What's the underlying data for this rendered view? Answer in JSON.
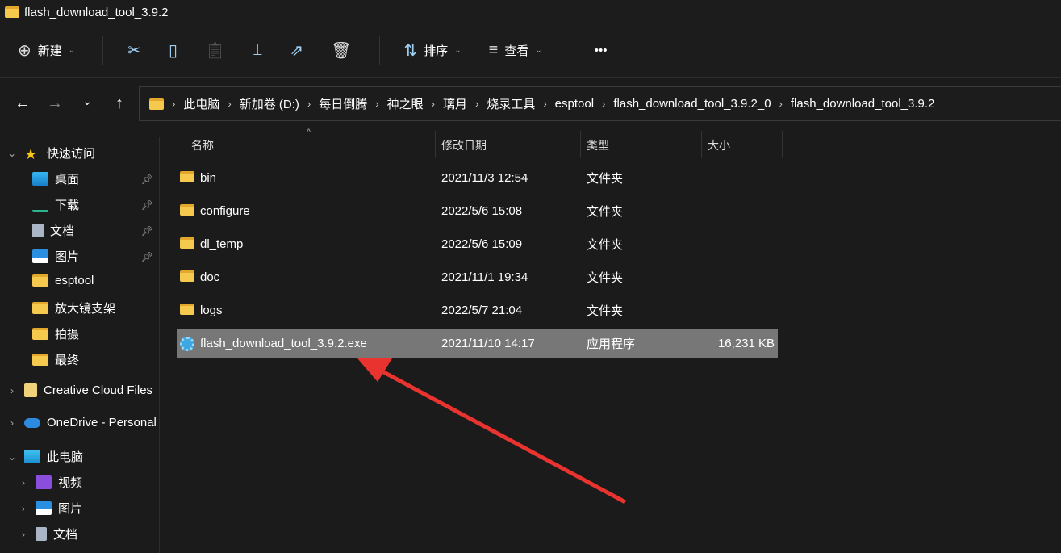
{
  "window": {
    "title": "flash_download_tool_3.9.2"
  },
  "toolbar": {
    "new": "新建",
    "sort": "排序",
    "view": "查看",
    "more": "•••"
  },
  "address": {
    "crumbs": [
      "此电脑",
      "新加卷 (D:)",
      "每日倒腾",
      "神之眼",
      "璃月",
      "烧录工具",
      "esptool",
      "flash_download_tool_3.9.2_0",
      "flash_download_tool_3.9.2"
    ]
  },
  "sidebar": {
    "quick_access": "快速访问",
    "quick_items": [
      "桌面",
      "下载",
      "文档",
      "图片",
      "esptool",
      "放大镜支架",
      "拍摄",
      "最终"
    ],
    "creative": "Creative Cloud Files",
    "onedrive": "OneDrive - Personal",
    "this_pc": "此电脑",
    "pc_items": [
      "视频",
      "图片",
      "文档"
    ]
  },
  "columns": {
    "name": "名称",
    "date": "修改日期",
    "type": "类型",
    "size": "大小"
  },
  "files": [
    {
      "name": "bin",
      "date": "2021/11/3 12:54",
      "type": "文件夹",
      "size": ""
    },
    {
      "name": "configure",
      "date": "2022/5/6 15:08",
      "type": "文件夹",
      "size": ""
    },
    {
      "name": "dl_temp",
      "date": "2022/5/6 15:09",
      "type": "文件夹",
      "size": ""
    },
    {
      "name": "doc",
      "date": "2021/11/1 19:34",
      "type": "文件夹",
      "size": ""
    },
    {
      "name": "logs",
      "date": "2022/5/7 21:04",
      "type": "文件夹",
      "size": ""
    },
    {
      "name": "flash_download_tool_3.9.2.exe",
      "date": "2021/11/10 14:17",
      "type": "应用程序",
      "size": "16,231 KB"
    }
  ],
  "colors": {
    "selected": "#777777",
    "arrow": "#e8332f"
  }
}
